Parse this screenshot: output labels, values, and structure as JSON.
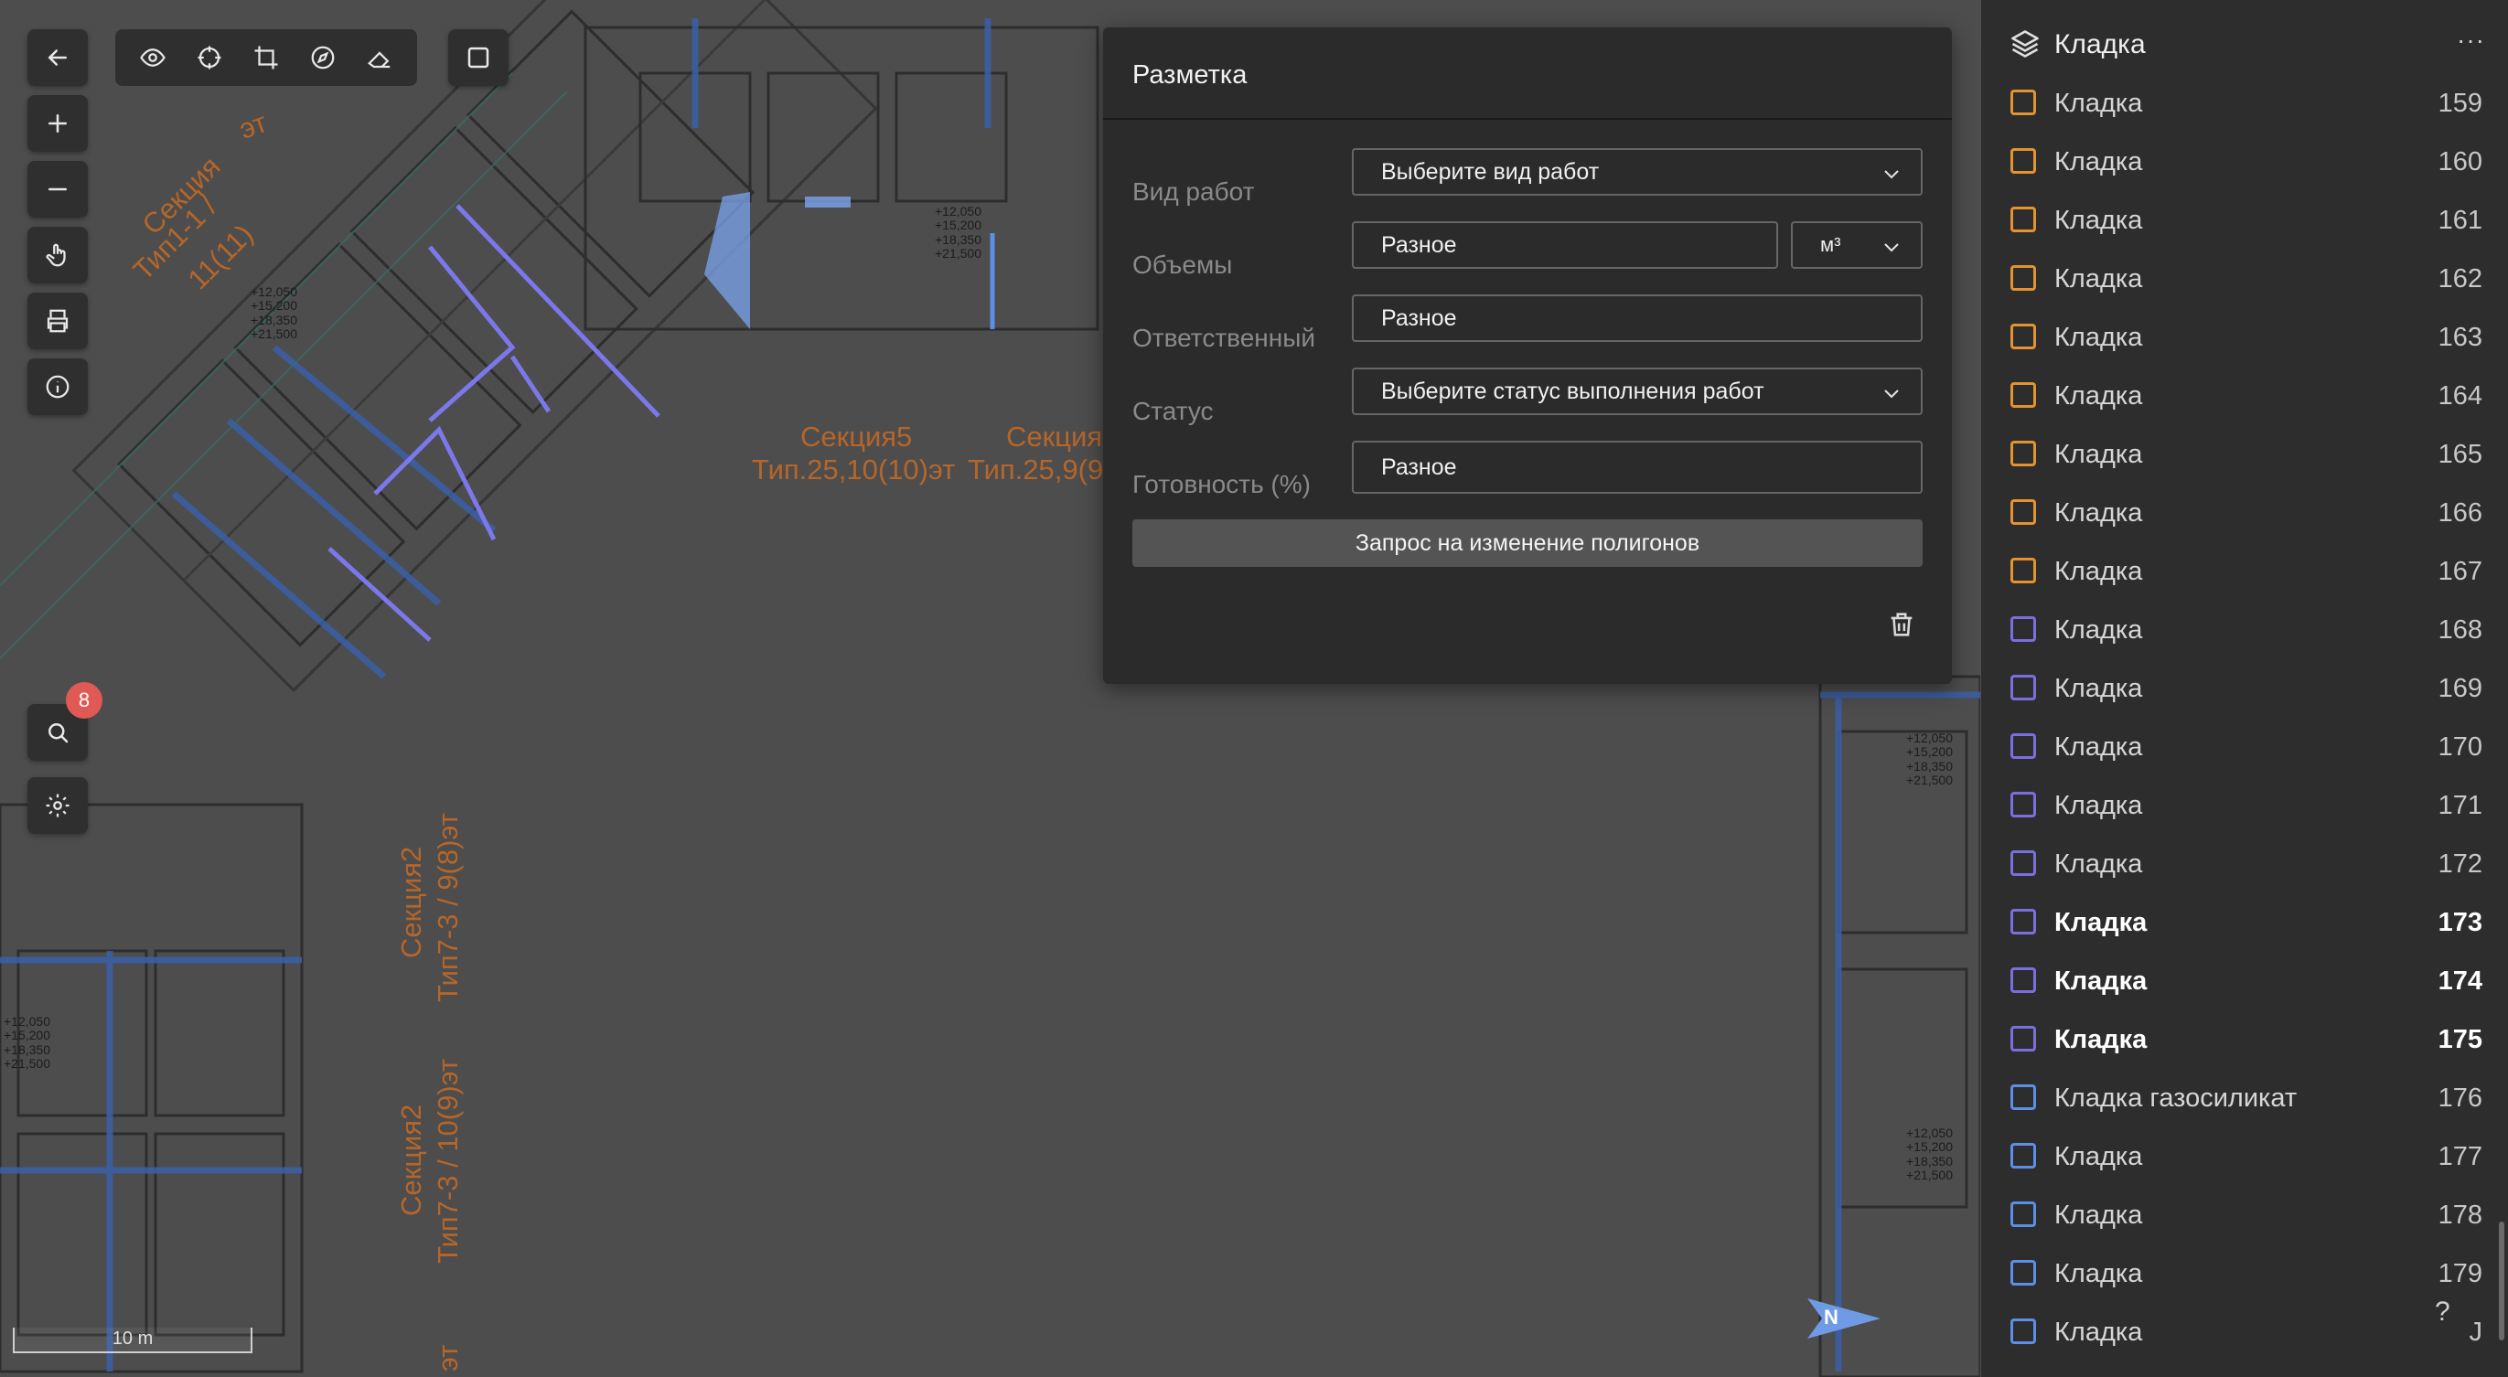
{
  "map": {
    "labels": [
      {
        "id": "sec-a",
        "text": "Секция"
      },
      {
        "id": "sec-a2",
        "text": "Тип1-1 /"
      },
      {
        "id": "sec-a3",
        "text": "11(11)"
      },
      {
        "id": "sec-a4",
        "text": "эт"
      },
      {
        "id": "sec-b",
        "text": "Секция5"
      },
      {
        "id": "sec-b2",
        "text": "Тип.25,10(10)эт"
      },
      {
        "id": "sec-c",
        "text": "Секция"
      },
      {
        "id": "sec-c2",
        "text": "Тип.25,9(9"
      },
      {
        "id": "sec-d",
        "text": "Секция2"
      },
      {
        "id": "sec-d2",
        "text": "Тип7-3 / 9(8)эт"
      },
      {
        "id": "sec-e",
        "text": "Секция2"
      },
      {
        "id": "sec-e2",
        "text": "Тип7-3 / 10(9)эт"
      },
      {
        "id": "sec-f",
        "text": "эт"
      }
    ],
    "elevations": "+12,050\n+15,200\n+18,350\n+21,500",
    "scale_label": "10 m",
    "north_label": "N",
    "search_badge": "8"
  },
  "dialog": {
    "title": "Разметка",
    "work_type_label": "Вид работ",
    "work_type_value": "Выберите вид работ",
    "volumes_label": "Объемы",
    "volumes_value": "Разное",
    "unit_value": "м³",
    "responsible_label": "Ответственный",
    "responsible_value": "Разное",
    "status_label": "Статус",
    "status_value": "Выберите статус выполнения работ",
    "readiness_label": "Готовность (%)",
    "readiness_value": "Разное",
    "request_button": "Запрос на изменение полигонов"
  },
  "panel": {
    "title": "Кладка",
    "more": "···",
    "help": "?",
    "colors": {
      "orange": "#e3932f",
      "violet": "#7b6fe0",
      "blue": "#5b8fe8"
    },
    "rows": [
      {
        "name": "Кладка",
        "num": "159",
        "color": "#e3932f",
        "bold": false
      },
      {
        "name": "Кладка",
        "num": "160",
        "color": "#e3932f",
        "bold": false
      },
      {
        "name": "Кладка",
        "num": "161",
        "color": "#e3932f",
        "bold": false
      },
      {
        "name": "Кладка",
        "num": "162",
        "color": "#e3932f",
        "bold": false
      },
      {
        "name": "Кладка",
        "num": "163",
        "color": "#e3932f",
        "bold": false
      },
      {
        "name": "Кладка",
        "num": "164",
        "color": "#e3932f",
        "bold": false
      },
      {
        "name": "Кладка",
        "num": "165",
        "color": "#e3932f",
        "bold": false
      },
      {
        "name": "Кладка",
        "num": "166",
        "color": "#e3932f",
        "bold": false
      },
      {
        "name": "Кладка",
        "num": "167",
        "color": "#e3932f",
        "bold": false
      },
      {
        "name": "Кладка",
        "num": "168",
        "color": "#7b6fe0",
        "bold": false
      },
      {
        "name": "Кладка",
        "num": "169",
        "color": "#7b6fe0",
        "bold": false
      },
      {
        "name": "Кладка",
        "num": "170",
        "color": "#7b6fe0",
        "bold": false
      },
      {
        "name": "Кладка",
        "num": "171",
        "color": "#7b6fe0",
        "bold": false
      },
      {
        "name": "Кладка",
        "num": "172",
        "color": "#7b6fe0",
        "bold": false
      },
      {
        "name": "Кладка",
        "num": "173",
        "color": "#7b6fe0",
        "bold": true
      },
      {
        "name": "Кладка",
        "num": "174",
        "color": "#7b6fe0",
        "bold": true
      },
      {
        "name": "Кладка",
        "num": "175",
        "color": "#7b6fe0",
        "bold": true
      },
      {
        "name": "Кладка газосиликат",
        "num": "176",
        "color": "#5b8fe8",
        "bold": false
      },
      {
        "name": "Кладка",
        "num": "177",
        "color": "#5b8fe8",
        "bold": false
      },
      {
        "name": "Кладка",
        "num": "178",
        "color": "#5b8fe8",
        "bold": false
      },
      {
        "name": "Кладка",
        "num": "179",
        "color": "#5b8fe8",
        "bold": false
      },
      {
        "name": "Кладка",
        "num": "J",
        "color": "#5b8fe8",
        "bold": false
      }
    ]
  }
}
